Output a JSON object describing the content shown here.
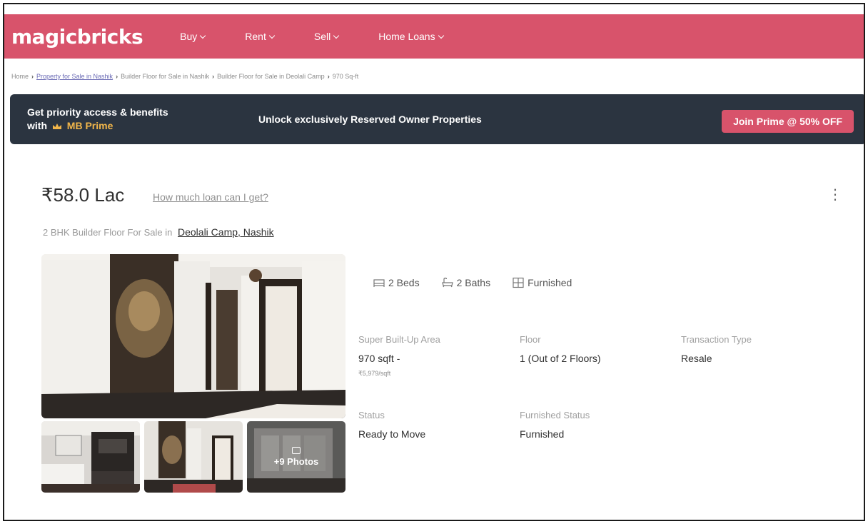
{
  "header": {
    "logo": "magicbricks",
    "nav": [
      {
        "label": "Buy"
      },
      {
        "label": "Rent"
      },
      {
        "label": "Sell"
      },
      {
        "label": "Home Loans"
      }
    ]
  },
  "breadcrumb": [
    {
      "label": "Home",
      "link": false
    },
    {
      "label": "Property for Sale in Nashik",
      "link": true
    },
    {
      "label": "Builder Floor for Sale in Nashik",
      "link": false
    },
    {
      "label": "Builder Floor for Sale in Deolali Camp",
      "link": false
    },
    {
      "label": "970 Sq-ft",
      "link": false
    }
  ],
  "prime_banner": {
    "line1": "Get priority access & benefits",
    "line2_prefix": "with",
    "line2_brand": "MB Prime",
    "middle": "Unlock exclusively Reserved Owner Properties",
    "button": "Join Prime @ 50% OFF"
  },
  "property": {
    "price": "₹58.0 Lac",
    "loan_link": "How much loan can I get?",
    "subtitle": "2 BHK Builder Floor For Sale in",
    "location": "Deolali Camp, Nashik",
    "more_photos": "+9 Photos",
    "features": [
      {
        "icon": "bed-icon",
        "label": "2 Beds"
      },
      {
        "icon": "bath-icon",
        "label": "2 Baths"
      },
      {
        "icon": "furnished-icon",
        "label": "Furnished"
      }
    ],
    "details": {
      "area_label": "Super Built-Up Area",
      "area_value": "970 sqft -",
      "area_rate": "₹5,979/sqft",
      "floor_label": "Floor",
      "floor_value": "1 (Out of 2 Floors)",
      "transaction_label": "Transaction Type",
      "transaction_value": "Resale",
      "status_label": "Status",
      "status_value": "Ready to Move",
      "furnished_label": "Furnished Status",
      "furnished_value": "Furnished"
    }
  },
  "colors": {
    "brand": "#d8536b",
    "banner_bg": "#2b3440",
    "prime_gold": "#f2b64a"
  }
}
